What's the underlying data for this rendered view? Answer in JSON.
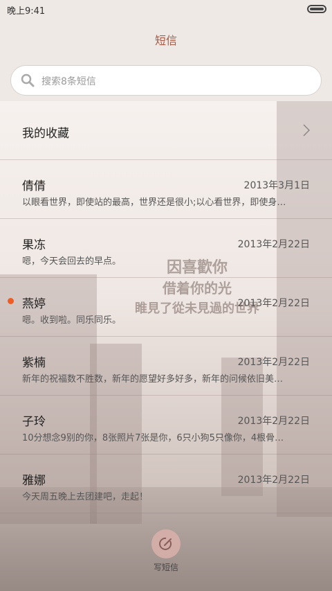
{
  "status_bar": {
    "time": "晚上9:41"
  },
  "header": {
    "title": "短信"
  },
  "search": {
    "placeholder": "搜索8条短信"
  },
  "favorites": {
    "label": "我的收藏"
  },
  "background_text": [
    "因喜歡你",
    "借着你的光",
    "睢見了從未見過的世界"
  ],
  "messages": [
    {
      "name": "倩倩",
      "date": "2013年3月1日",
      "preview": "以眼看世界，即使站的最高，世界还是很小;以心看世界，即使身…",
      "unread": false
    },
    {
      "name": "果冻",
      "date": "2013年2月22日",
      "preview": "嗯，今天会回去的早点。",
      "unread": false
    },
    {
      "name": "燕婷",
      "date": "2013年2月22日",
      "preview": "嗯。收到啦。同乐同乐。",
      "unread": true
    },
    {
      "name": "紫楠",
      "date": "2013年2月22日",
      "preview": "新年的祝福数不胜数，新年的愿望好多好多，新年的问候依旧美…",
      "unread": false
    },
    {
      "name": "子玲",
      "date": "2013年2月22日",
      "preview": "10分想念9别的你，8张照片7张是你，6只小狗5只像你，4根骨…",
      "unread": false
    },
    {
      "name": "雅娜",
      "date": "2013年2月22日",
      "preview": "今天周五晚上去团建吧，走起！",
      "unread": false
    }
  ],
  "compose": {
    "label": "写短信"
  },
  "colors": {
    "accent": "#a45a44",
    "unread_dot": "#ef5d25",
    "compose_bg": "#d7afaa"
  }
}
